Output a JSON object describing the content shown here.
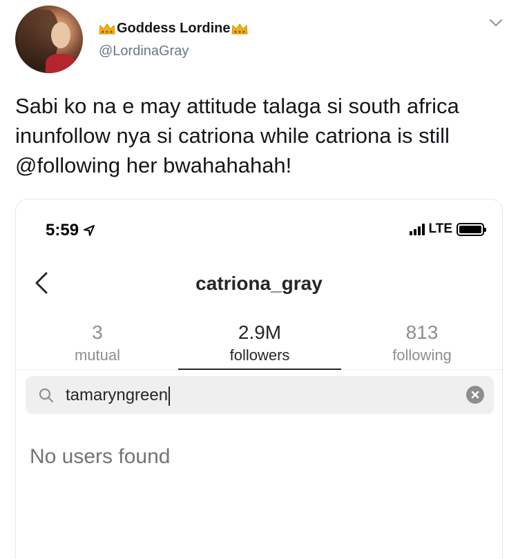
{
  "tweet": {
    "display_name": "Goddess Lordine",
    "handle": "@LordinaGray",
    "text": "Sabi ko na e may attitude talaga si south africa\ninunfollow nya si catriona while catriona is  still\n@following her bwahahahah!"
  },
  "screenshot": {
    "status_bar": {
      "time": "5:59",
      "network": "LTE"
    },
    "profile_title": "catriona_gray",
    "tabs": [
      {
        "number": "3",
        "label": "mutual"
      },
      {
        "number": "2.9M",
        "label": "followers"
      },
      {
        "number": "813",
        "label": "following"
      }
    ],
    "search": {
      "value": "tamaryngreen"
    },
    "empty_message": "No users found"
  },
  "colors": {
    "accent": "#262626",
    "muted": "#8e8e8e",
    "search_bg": "#efefef"
  }
}
